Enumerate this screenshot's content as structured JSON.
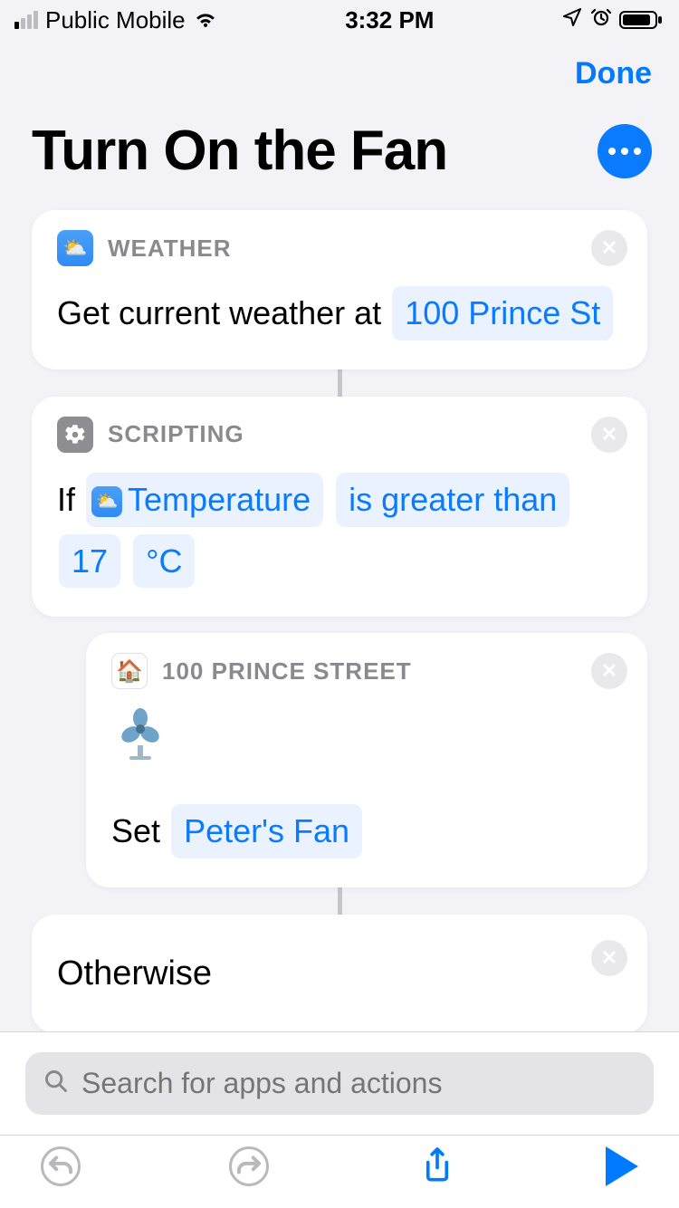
{
  "status_bar": {
    "carrier": "Public Mobile",
    "time": "3:32 PM"
  },
  "nav": {
    "done_label": "Done"
  },
  "title": "Turn On the Fan",
  "actions": {
    "weather": {
      "app_label": "WEATHER",
      "prefix": "Get current weather at",
      "location": "100 Prince St"
    },
    "if": {
      "app_label": "SCRIPTING",
      "keyword": "If",
      "variable": "Temperature",
      "condition": "is greater than",
      "value": "17",
      "unit": "°C"
    },
    "home": {
      "app_label": "100 PRINCE STREET",
      "prefix": "Set",
      "accessory": "Peter's Fan"
    },
    "otherwise": {
      "label": "Otherwise"
    }
  },
  "search": {
    "placeholder": "Search for apps and actions"
  }
}
